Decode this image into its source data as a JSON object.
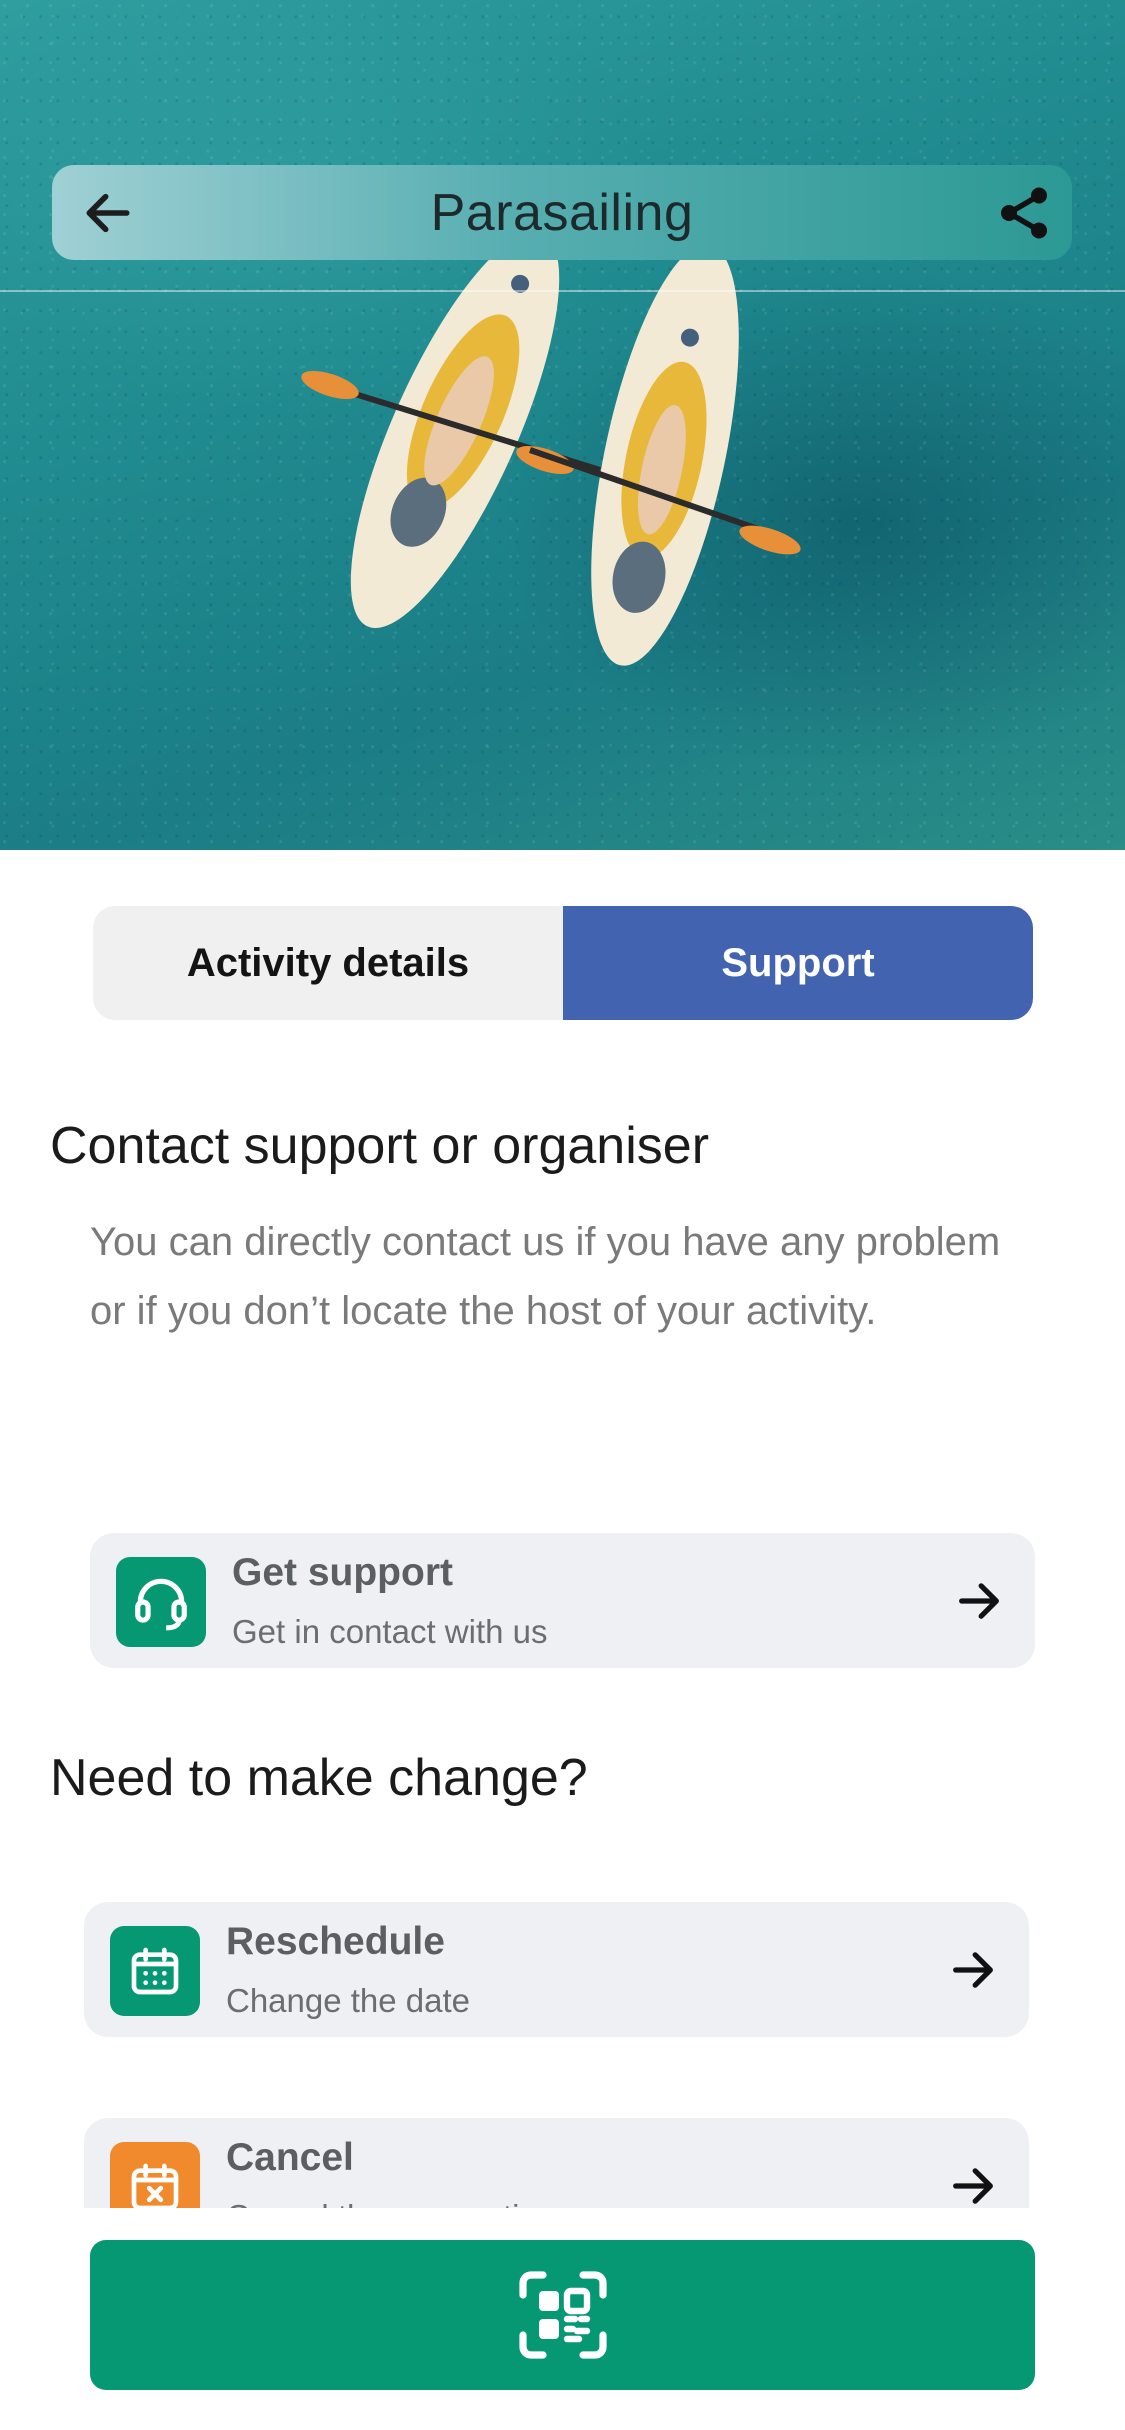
{
  "header": {
    "title": "Parasailing",
    "back_icon": "arrow-left-icon",
    "share_icon": "share-icon"
  },
  "hero": {
    "image": "aerial photo of two kayaks on turquoise water"
  },
  "tabs": [
    {
      "label": "Activity details",
      "active": false
    },
    {
      "label": "Support",
      "active": true
    }
  ],
  "contact": {
    "title": "Contact support or organiser",
    "description": "You can directly contact us if you have any problem or if you don’t locate the host of your activity."
  },
  "support_card": {
    "title": "Get support",
    "subtitle": "Get in contact with us",
    "icon": "headset-icon",
    "color": "#069873"
  },
  "change": {
    "title": "Need to make change?"
  },
  "reschedule_card": {
    "title": "Reschedule",
    "subtitle": "Change the date",
    "icon": "calendar-icon",
    "color": "#069873"
  },
  "cancel_card": {
    "title": "Cancel",
    "subtitle": "Cancel the reservation",
    "icon": "calendar-cancel-icon",
    "color": "#f08a2c"
  },
  "scan_button": {
    "icon": "qr-scan-icon",
    "color": "#069873"
  },
  "colors": {
    "accent_blue": "#4263b0",
    "accent_green": "#069873"
  }
}
